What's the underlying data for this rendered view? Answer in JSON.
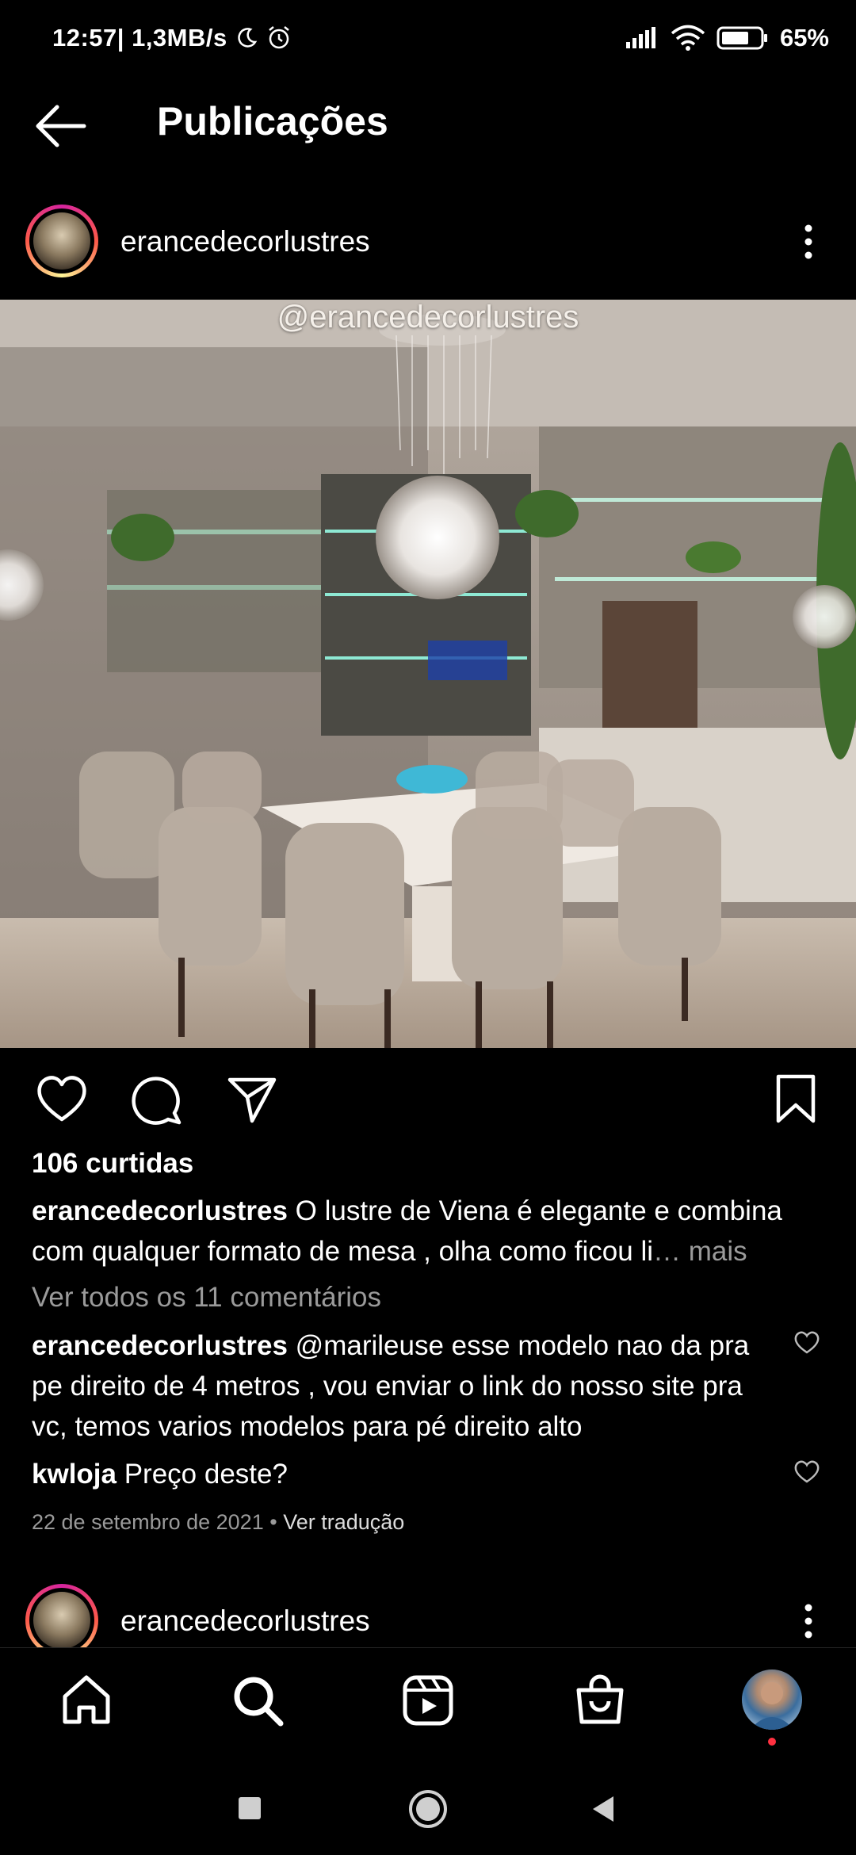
{
  "status_bar": {
    "time": "12:57",
    "speed": "| 1,3MB/s",
    "battery": "65%",
    "icons": [
      "moon-icon",
      "alarm-icon",
      "signal-icon",
      "wifi-icon",
      "battery-icon"
    ]
  },
  "header": {
    "title": "Publicações",
    "back_icon": "arrow-left-icon"
  },
  "post": {
    "username": "erancedecorlustres",
    "image_watermark": "@erancedecorlustres",
    "likes": "106 curtidas",
    "caption_user": "erancedecorlustres",
    "caption_text": " O lustre de Viena é elegante e combina com qualquer formato de mesa , olha como ficou li",
    "caption_more": "… mais",
    "view_comments": "Ver todos os 11 comentários",
    "comments": [
      {
        "user": "erancedecorlustres",
        "mention": " @marileuse",
        "text": " esse modelo nao da pra pe direito de 4 metros , vou enviar o link do nosso site pra vc, temos varios modelos para pé direito alto"
      },
      {
        "user": "kwloja",
        "mention": "",
        "text": " Preço deste?"
      }
    ],
    "date": "22 de setembro de 2021",
    "separator": " • ",
    "translate": "Ver tradução"
  },
  "next_post": {
    "username": "erancedecorlustres"
  },
  "bottom_nav": [
    "home-icon",
    "search-icon",
    "reels-icon",
    "shop-icon",
    "profile-avatar"
  ],
  "colors": {
    "background": "#000000",
    "muted": "#9a9a9a",
    "notification_dot": "#ff3040"
  }
}
